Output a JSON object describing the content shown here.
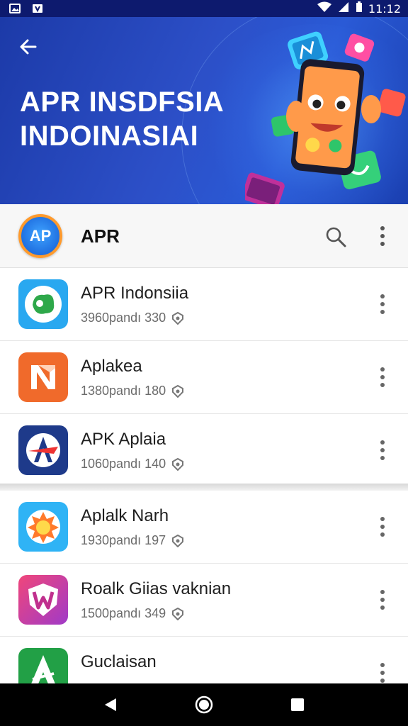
{
  "status_bar": {
    "time": "11:12"
  },
  "hero": {
    "title_line1": "APR INSDFSIA",
    "title_line2": "INDOINASIAI"
  },
  "header": {
    "app_name": "APR",
    "logo_text": "AP"
  },
  "apps": [
    {
      "title": "APR Indonsiia",
      "meta": "3960pandı 330",
      "icon": "green-blob-icon",
      "color": "#29a8f0"
    },
    {
      "title": "Aplakea",
      "meta": "1380pandı 180",
      "icon": "n-logo-icon",
      "color": "#f06a2b"
    },
    {
      "title": "APK Aplaia",
      "meta": "1060pandı 140",
      "icon": "a-star-logo-icon",
      "color": "#1e3a8a"
    },
    {
      "title": "Aplalk Narh",
      "meta": "1930pandı 197",
      "icon": "sun-badge-icon",
      "color": "#2fb3f5"
    },
    {
      "title": "Roalk Giias vaknian",
      "meta": "1500pandı 349",
      "icon": "w-shield-icon",
      "color": "#d63a9a"
    },
    {
      "title": "Guclaisan",
      "meta": "",
      "icon": "a-tree-logo-icon",
      "color": "#22a046"
    }
  ],
  "colors": {
    "hero_bg": "#2c4fc7",
    "status_bar": "#0d1a6e",
    "nav_bar": "#000000"
  }
}
